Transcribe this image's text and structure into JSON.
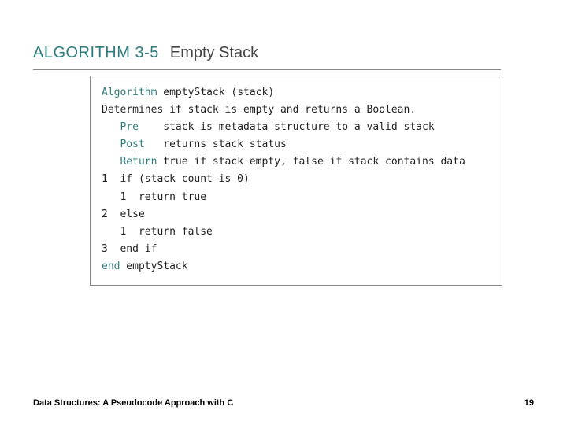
{
  "header": {
    "label": "ALGORITHM 3-5",
    "title": "Empty Stack"
  },
  "code": {
    "l1a": "Algorithm",
    "l1b": " emptyStack (stack)",
    "l2": "Determines if stack is empty and returns a Boolean.",
    "l3a": "   Pre",
    "l3b": "    stack is metadata structure to a valid stack",
    "l4a": "   Post",
    "l4b": "   returns stack status",
    "l5a": "   Return",
    "l5b": " true if stack empty, false if stack contains data",
    "l6": "1  if (stack count is 0)",
    "l7": "   1  return true",
    "l8": "2  else",
    "l9": "   1  return false",
    "l10": "3  end if",
    "l11a": "end",
    "l11b": " emptyStack"
  },
  "footer": {
    "text": "Data Structures: A Pseudocode Approach with C",
    "page": "19"
  }
}
